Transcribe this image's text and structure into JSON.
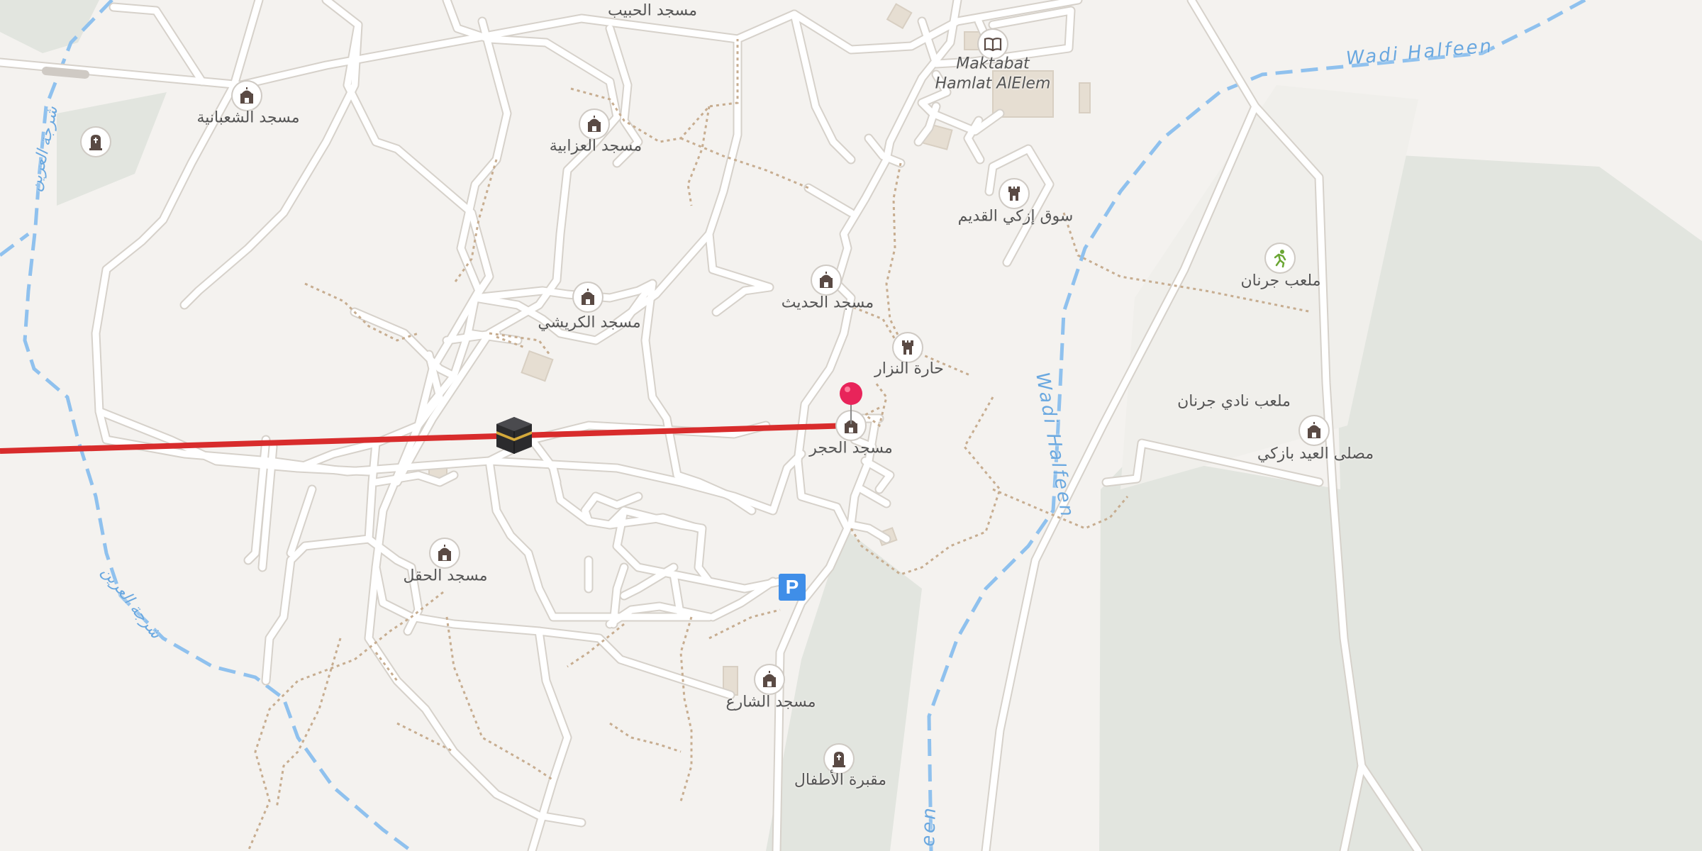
{
  "map": {
    "places": {
      "mosque_habib": "مسجد الحبيب",
      "mosque_shaabaniya": "مسجد الشعبانية",
      "mosque_azabiya": "مسجد العزابية",
      "mosque_kraishi": "مسجد الكريشي",
      "mosque_hadith": "مسجد الحديث",
      "mosque_hajar": "مسجد الحجر",
      "mosque_haql": "مسجد الحقل",
      "mosque_sharea": "مسجد الشارع",
      "eid_prayer_ground": "مصلى العيد بازكي",
      "old_souk": "سوق إزكي القديم",
      "harat_nizar": "حارة النزار",
      "jarnan_stadium": "ملعب جرنان",
      "jarnan_club_stadium": "ملعب نادي جرنان",
      "children_cemetery": "مقبرة الأطفال",
      "library_line1": "Maktabat",
      "library_line2": "Hamlat AlElem"
    },
    "waterways": {
      "wadi_halfeen_top": "Wadi Halfeen",
      "wadi_halfeen_mid": "Wadi Halfeen",
      "wadi_halfeen_bottom": "een",
      "west_wadi_upper": "شرجة العرين",
      "west_wadi_lower": "شرجة العرين"
    },
    "icons": {
      "mosque": "mosque-icon",
      "tower": "tower-icon",
      "library": "book-icon",
      "cemetery": "gravestone-icon",
      "sports": "running-icon",
      "parking": "parking-icon",
      "kaaba": "kaaba-icon",
      "pin": "location-pin-icon"
    },
    "parking_symbol": "P",
    "colors": {
      "background": "#f4f2ef",
      "park": "#e2e5df",
      "road": "#ffffff",
      "road_casing": "#d6d1ca",
      "path": "#c7ad90",
      "water": "#8fc1ee",
      "route": "#d82c2c",
      "pin": "#e8245a",
      "parking": "#3f8ee8",
      "poi_icon": "#5a4a44",
      "sports_icon": "#6aa633"
    }
  }
}
